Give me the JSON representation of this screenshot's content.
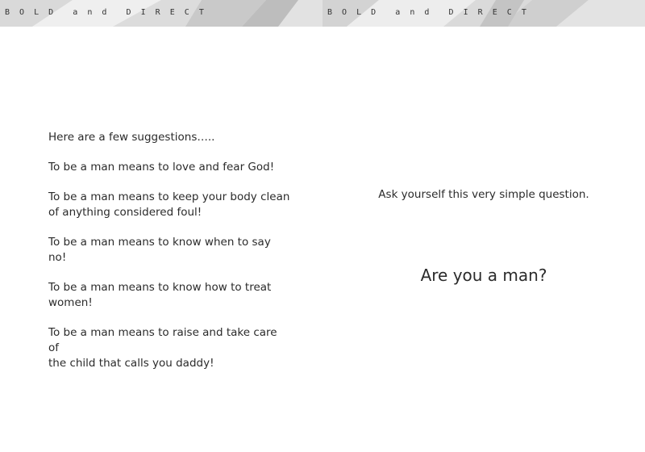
{
  "header": {
    "running_title": "B  O  L  D    a  n  d    D  I  R  E  C  T",
    "running_title_continued": "B  O  L  D    a  n  d    D  I  R  E  C  T"
  },
  "left_page": {
    "intro": "Here are a few suggestions…..",
    "suggestions": [
      [
        "To be a man means to love and fear God!"
      ],
      [
        "To be a man means to keep your body clean",
        "of anything considered foul!"
      ],
      [
        "To be a man means to know when to say no!"
      ],
      [
        "To be a man means to know how to treat",
        "women!"
      ],
      [
        "To be a man means to raise and take care of",
        "the child that calls you daddy!"
      ]
    ]
  },
  "right_page": {
    "prompt": "Ask yourself this very simple question.",
    "question": "Are you a man?"
  },
  "colors": {
    "header_band": "#e7e7e7",
    "text": "#2b2b2b"
  }
}
